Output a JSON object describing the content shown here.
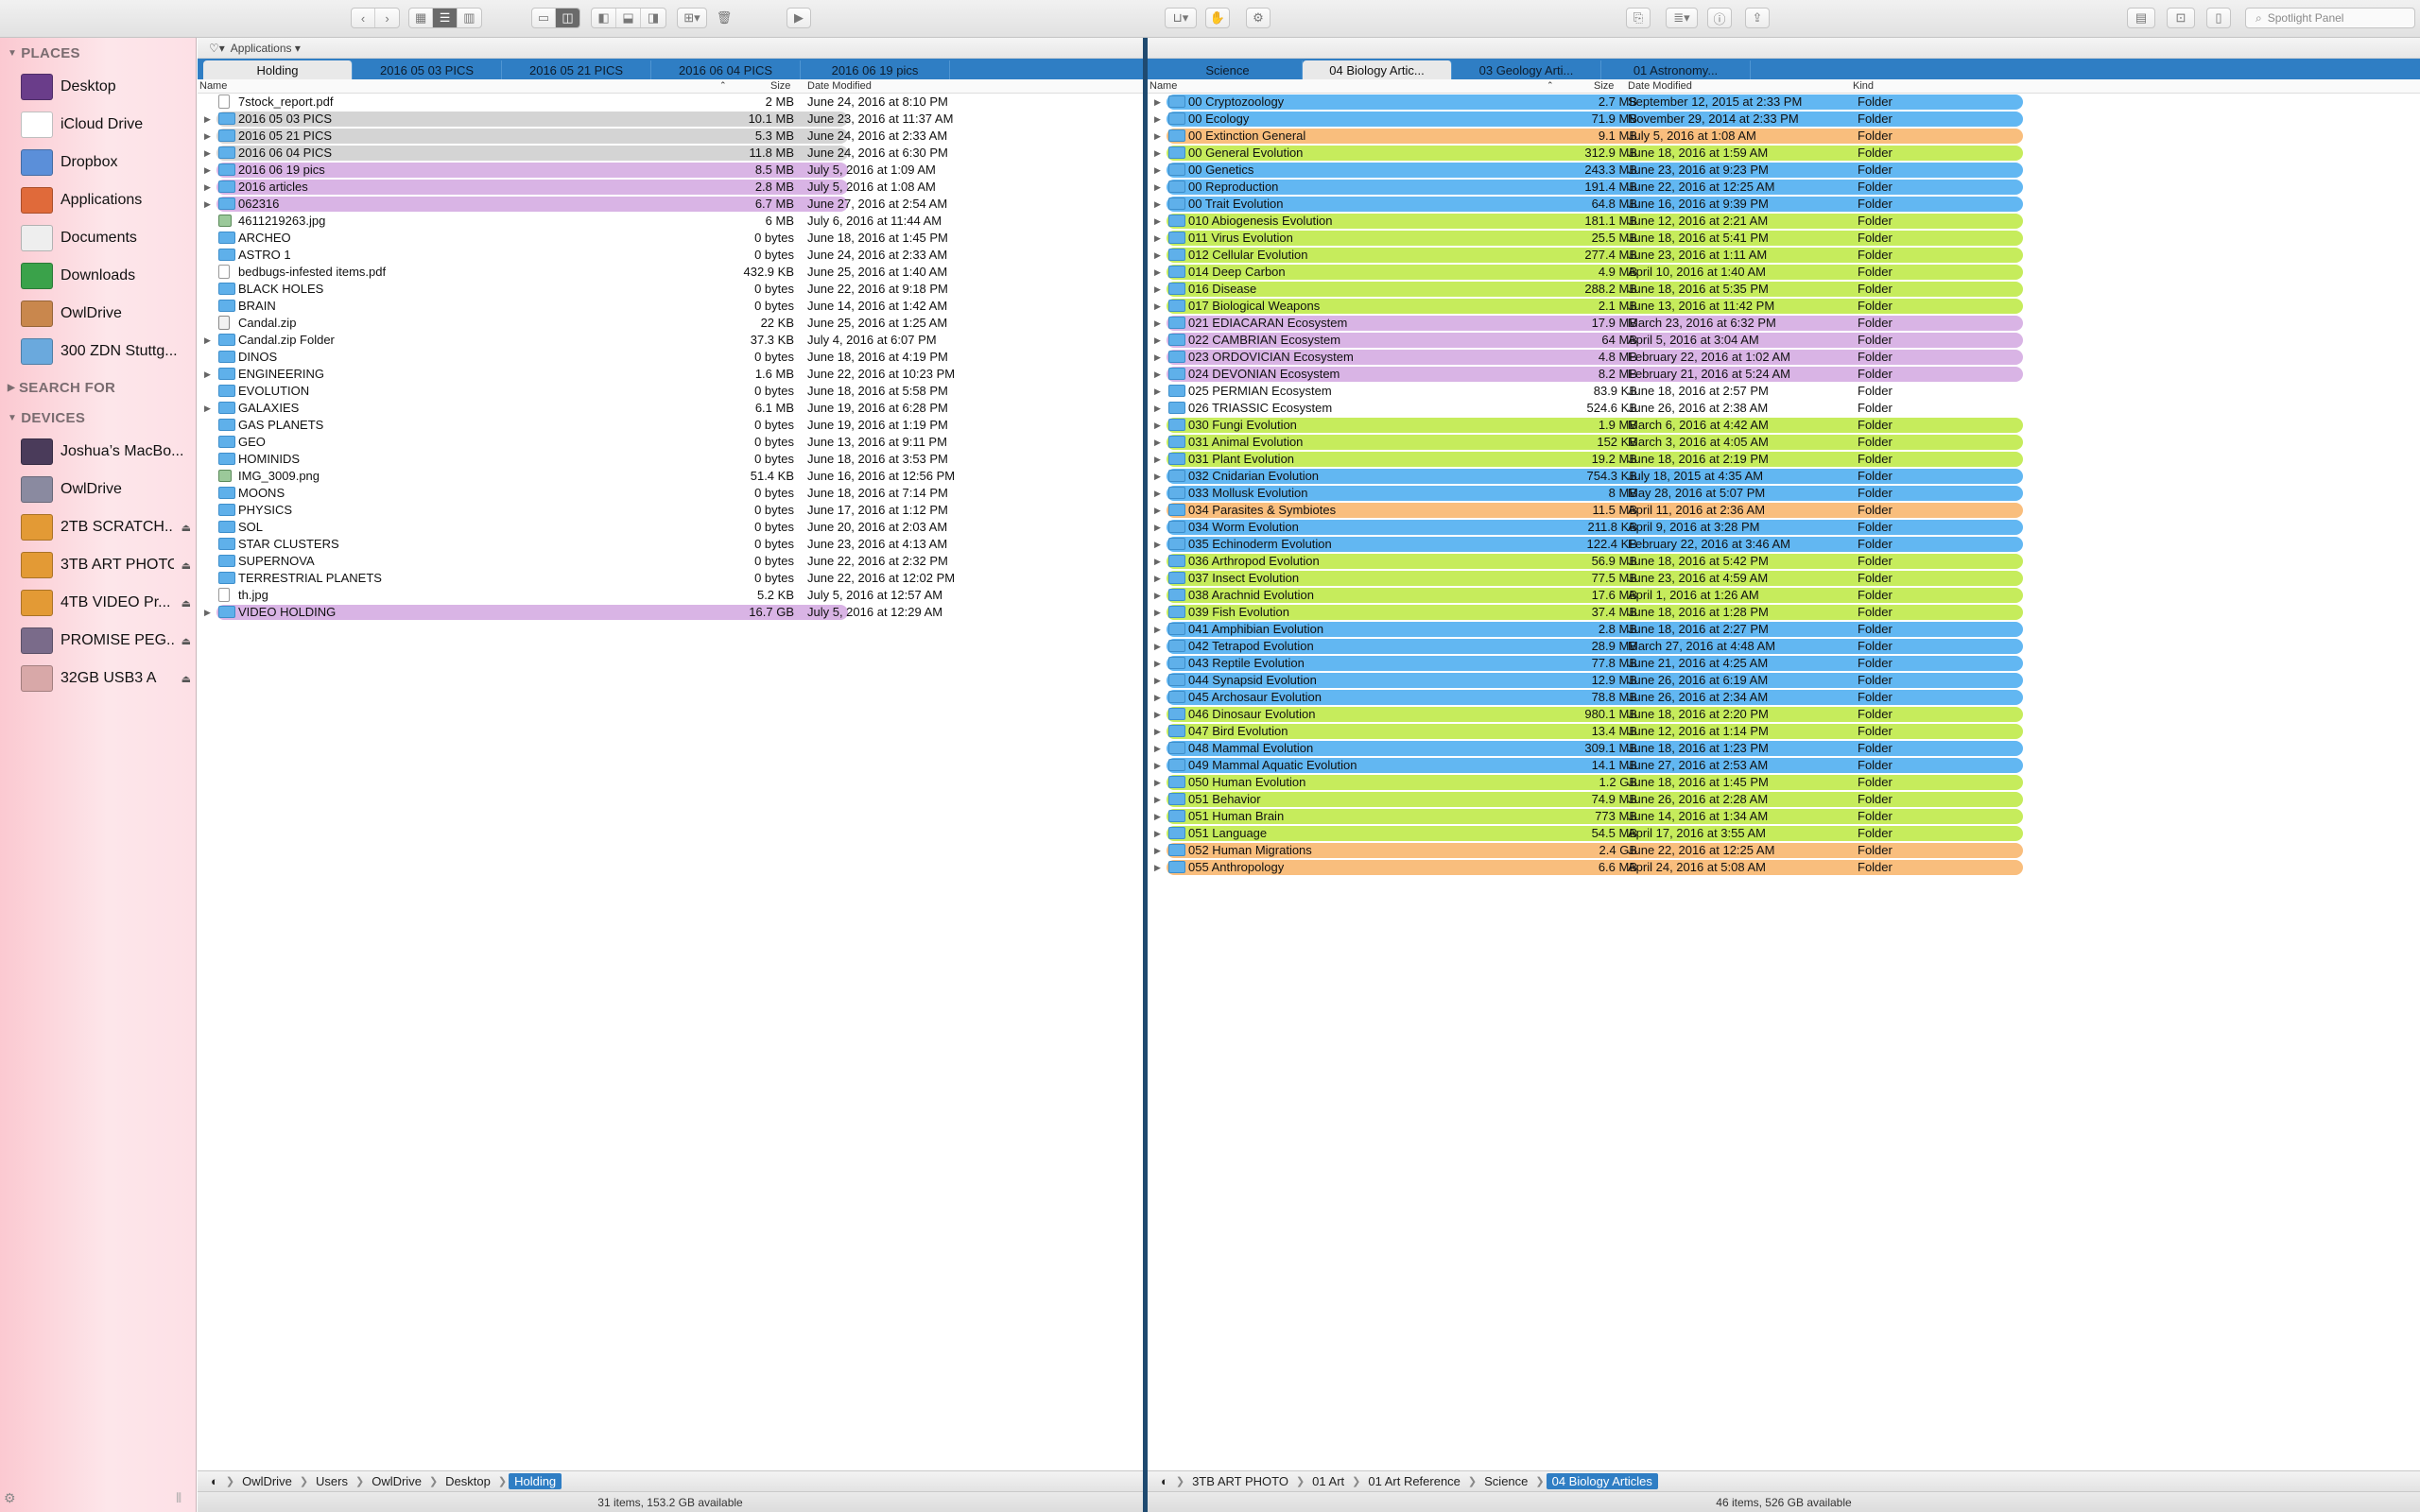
{
  "toolbar": {
    "back_icon": "chevron-left-icon",
    "forward_icon": "chevron-right-icon",
    "search_placeholder": "Spotlight Panel",
    "colors": {
      "accent": "#2f7ec4"
    }
  },
  "sidebar": {
    "sections": {
      "places": "PLACES",
      "search_for": "SEARCH FOR",
      "devices": "DEVICES"
    },
    "places": [
      {
        "label": "Desktop",
        "icon": "desktop-icon"
      },
      {
        "label": "iCloud Drive",
        "icon": "cloud-icon"
      },
      {
        "label": "Dropbox",
        "icon": "dropbox-icon"
      },
      {
        "label": "Applications",
        "icon": "applications-icon"
      },
      {
        "label": "Documents",
        "icon": "documents-icon"
      },
      {
        "label": "Downloads",
        "icon": "downloads-icon"
      },
      {
        "label": "OwlDrive",
        "icon": "home-icon"
      },
      {
        "label": "300 ZDN Stuttg...",
        "icon": "folder-icon"
      }
    ],
    "devices": [
      {
        "label": "Joshua’s MacBo...",
        "icon": "laptop-icon",
        "eject": ""
      },
      {
        "label": "OwlDrive",
        "icon": "disk-icon",
        "eject": ""
      },
      {
        "label": "2TB SCRATCH...",
        "icon": "external-disk-icon",
        "eject": "⏏"
      },
      {
        "label": "3TB ART PHOTO",
        "icon": "external-disk-icon",
        "eject": "⏏"
      },
      {
        "label": "4TB VIDEO Pr...",
        "icon": "external-disk-icon",
        "eject": "⏏"
      },
      {
        "label": "PROMISE PEG...",
        "icon": "raid-disk-icon",
        "eject": "⏏"
      },
      {
        "label": "32GB USB3 A",
        "icon": "usb-disk-icon",
        "eject": "⏏"
      }
    ]
  },
  "left": {
    "bookmark": "Applications ▾",
    "tabs": [
      "Holding",
      "2016 05 03 PICS",
      "2016 05 21 PICS",
      "2016 06 04 PICS",
      "2016 06 19 pics"
    ],
    "columns": {
      "name": "Name",
      "size": "Size",
      "date": "Date Modified"
    },
    "rows": [
      {
        "name": "7stock_report.pdf",
        "size": "2 MB",
        "date": "June 24, 2016 at 8:10 PM",
        "type": "doc",
        "dis": false,
        "color": ""
      },
      {
        "name": "2016 05 03 PICS",
        "size": "10.1 MB",
        "date": "June 23, 2016 at 11:37 AM",
        "type": "folder",
        "dis": true,
        "color": "#d4d4d4"
      },
      {
        "name": "2016 05 21 PICS",
        "size": "5.3 MB",
        "date": "June 24, 2016 at 2:33 AM",
        "type": "folder",
        "dis": true,
        "color": "#d4d4d4"
      },
      {
        "name": "2016 06 04 PICS",
        "size": "11.8 MB",
        "date": "June 24, 2016 at 6:30 PM",
        "type": "folder",
        "dis": true,
        "color": "#d4d4d4"
      },
      {
        "name": "2016 06 19 pics",
        "size": "8.5 MB",
        "date": "July 5, 2016 at 1:09 AM",
        "type": "folder",
        "dis": true,
        "color": "#d9b4e5"
      },
      {
        "name": "2016 articles",
        "size": "2.8 MB",
        "date": "July 5, 2016 at 1:08 AM",
        "type": "folder",
        "dis": true,
        "color": "#d9b4e5"
      },
      {
        "name": "062316",
        "size": "6.7 MB",
        "date": "June 27, 2016 at 2:54 AM",
        "type": "folder",
        "dis": true,
        "color": "#d9b4e5"
      },
      {
        "name": "4611219263.jpg",
        "size": "6 MB",
        "date": "July 6, 2016 at 11:44 AM",
        "type": "img",
        "dis": false,
        "color": ""
      },
      {
        "name": "ARCHEO",
        "size": "0 bytes",
        "date": "June 18, 2016 at 1:45 PM",
        "type": "folder",
        "dis": false,
        "color": ""
      },
      {
        "name": "ASTRO 1",
        "size": "0 bytes",
        "date": "June 24, 2016 at 2:33 AM",
        "type": "folder",
        "dis": false,
        "color": ""
      },
      {
        "name": "bedbugs-infested items.pdf",
        "size": "432.9 KB",
        "date": "June 25, 2016 at 1:40 AM",
        "type": "doc",
        "dis": false,
        "color": ""
      },
      {
        "name": "BLACK HOLES",
        "size": "0 bytes",
        "date": "June 22, 2016 at 9:18 PM",
        "type": "folder",
        "dis": false,
        "color": ""
      },
      {
        "name": "BRAIN",
        "size": "0 bytes",
        "date": "June 14, 2016 at 1:42 AM",
        "type": "folder",
        "dis": false,
        "color": ""
      },
      {
        "name": "Candal.zip",
        "size": "22 KB",
        "date": "June 25, 2016 at 1:25 AM",
        "type": "zip",
        "dis": false,
        "color": ""
      },
      {
        "name": "Candal.zip Folder",
        "size": "37.3 KB",
        "date": "July 4, 2016 at 6:07 PM",
        "type": "folder",
        "dis": true,
        "color": ""
      },
      {
        "name": "DINOS",
        "size": "0 bytes",
        "date": "June 18, 2016 at 4:19 PM",
        "type": "folder",
        "dis": false,
        "color": ""
      },
      {
        "name": "ENGINEERING",
        "size": "1.6 MB",
        "date": "June 22, 2016 at 10:23 PM",
        "type": "folder",
        "dis": true,
        "color": ""
      },
      {
        "name": "EVOLUTION",
        "size": "0 bytes",
        "date": "June 18, 2016 at 5:58 PM",
        "type": "folder",
        "dis": false,
        "color": ""
      },
      {
        "name": "GALAXIES",
        "size": "6.1 MB",
        "date": "June 19, 2016 at 6:28 PM",
        "type": "folder",
        "dis": true,
        "color": ""
      },
      {
        "name": "GAS PLANETS",
        "size": "0 bytes",
        "date": "June 19, 2016 at 1:19 PM",
        "type": "folder",
        "dis": false,
        "color": ""
      },
      {
        "name": "GEO",
        "size": "0 bytes",
        "date": "June 13, 2016 at 9:11 PM",
        "type": "folder",
        "dis": false,
        "color": ""
      },
      {
        "name": "HOMINIDS",
        "size": "0 bytes",
        "date": "June 18, 2016 at 3:53 PM",
        "type": "folder",
        "dis": false,
        "color": ""
      },
      {
        "name": "IMG_3009.png",
        "size": "51.4 KB",
        "date": "June 16, 2016 at 12:56 PM",
        "type": "img",
        "dis": false,
        "color": ""
      },
      {
        "name": "MOONS",
        "size": "0 bytes",
        "date": "June 18, 2016 at 7:14 PM",
        "type": "folder",
        "dis": false,
        "color": ""
      },
      {
        "name": "PHYSICS",
        "size": "0 bytes",
        "date": "June 17, 2016 at 1:12 PM",
        "type": "folder",
        "dis": false,
        "color": ""
      },
      {
        "name": "SOL",
        "size": "0 bytes",
        "date": "June 20, 2016 at 2:03 AM",
        "type": "folder",
        "dis": false,
        "color": ""
      },
      {
        "name": "STAR CLUSTERS",
        "size": "0 bytes",
        "date": "June 23, 2016 at 4:13 AM",
        "type": "folder",
        "dis": false,
        "color": ""
      },
      {
        "name": "SUPERNOVA",
        "size": "0 bytes",
        "date": "June 22, 2016 at 2:32 PM",
        "type": "folder",
        "dis": false,
        "color": ""
      },
      {
        "name": "TERRESTRIAL PLANETS",
        "size": "0 bytes",
        "date": "June 22, 2016 at 12:02 PM",
        "type": "folder",
        "dis": false,
        "color": ""
      },
      {
        "name": "th.jpg",
        "size": "5.2 KB",
        "date": "July 5, 2016 at 12:57 AM",
        "type": "doc",
        "dis": false,
        "color": ""
      },
      {
        "name": "VIDEO HOLDING",
        "size": "16.7 GB",
        "date": "July 5, 2016 at 12:29 AM",
        "type": "folder",
        "dis": true,
        "color": "#d9b4e5"
      }
    ],
    "path": [
      "OwlDrive",
      "Users",
      "OwlDrive",
      "Desktop",
      "Holding"
    ],
    "status": "31 items, 153.2 GB available"
  },
  "right": {
    "tabs": [
      "Science",
      "04 Biology Artic...",
      "03 Geology Arti...",
      "01 Astronomy..."
    ],
    "active_tab": 1,
    "columns": {
      "name": "Name",
      "size": "Size",
      "date": "Date Modified",
      "kind": "Kind"
    },
    "rows": [
      {
        "name": "00 Cryptozoology",
        "size": "2.7 MB",
        "date": "September 12, 2015 at 2:33 PM",
        "kind": "Folder",
        "color": "#62b7f2"
      },
      {
        "name": "00 Ecology",
        "size": "71.9 MB",
        "date": "November 29, 2014 at 2:33 PM",
        "kind": "Folder",
        "color": "#62b7f2"
      },
      {
        "name": "00 Extinction General",
        "size": "9.1 MB",
        "date": "July 5, 2016 at 1:08 AM",
        "kind": "Folder",
        "color": "#f9be7d"
      },
      {
        "name": "00 General Evolution",
        "size": "312.9 MB",
        "date": "June 18, 2016 at 1:59 AM",
        "kind": "Folder",
        "color": "#c6ec5c"
      },
      {
        "name": "00 Genetics",
        "size": "243.3 MB",
        "date": "June 23, 2016 at 9:23 PM",
        "kind": "Folder",
        "color": "#62b7f2"
      },
      {
        "name": "00 Reproduction",
        "size": "191.4 MB",
        "date": "June 22, 2016 at 12:25 AM",
        "kind": "Folder",
        "color": "#62b7f2"
      },
      {
        "name": "00 Trait Evolution",
        "size": "64.8 MB",
        "date": "June 16, 2016 at 9:39 PM",
        "kind": "Folder",
        "color": "#62b7f2"
      },
      {
        "name": "010 Abiogenesis Evolution",
        "size": "181.1 MB",
        "date": "June 12, 2016 at 2:21 AM",
        "kind": "Folder",
        "color": "#c6ec5c"
      },
      {
        "name": "011 Virus Evolution",
        "size": "25.5 MB",
        "date": "June 18, 2016 at 5:41 PM",
        "kind": "Folder",
        "color": "#c6ec5c"
      },
      {
        "name": "012 Cellular Evolution",
        "size": "277.4 MB",
        "date": "June 23, 2016 at 1:11 AM",
        "kind": "Folder",
        "color": "#c6ec5c"
      },
      {
        "name": "014 Deep Carbon",
        "size": "4.9 MB",
        "date": "April 10, 2016 at 1:40 AM",
        "kind": "Folder",
        "color": "#c6ec5c"
      },
      {
        "name": "016 Disease",
        "size": "288.2 MB",
        "date": "June 18, 2016 at 5:35 PM",
        "kind": "Folder",
        "color": "#c6ec5c"
      },
      {
        "name": "017 Biological Weapons",
        "size": "2.1 MB",
        "date": "June 13, 2016 at 11:42 PM",
        "kind": "Folder",
        "color": "#c6ec5c"
      },
      {
        "name": "021 EDIACARAN Ecosystem",
        "size": "17.9 MB",
        "date": "March 23, 2016 at 6:32 PM",
        "kind": "Folder",
        "color": "#d9b4e5"
      },
      {
        "name": "022 CAMBRIAN Ecosystem",
        "size": "64 MB",
        "date": "April 5, 2016 at 3:04 AM",
        "kind": "Folder",
        "color": "#d9b4e5"
      },
      {
        "name": "023 ORDOVICIAN Ecosystem",
        "size": "4.8 MB",
        "date": "February 22, 2016 at 1:02 AM",
        "kind": "Folder",
        "color": "#d9b4e5"
      },
      {
        "name": "024 DEVONIAN Ecosystem",
        "size": "8.2 MB",
        "date": "February 21, 2016 at 5:24 AM",
        "kind": "Folder",
        "color": "#d9b4e5"
      },
      {
        "name": "025 PERMIAN Ecosystem",
        "size": "83.9 KB",
        "date": "June 18, 2016 at 2:57 PM",
        "kind": "Folder",
        "color": ""
      },
      {
        "name": "026 TRIASSIC Ecosystem",
        "size": "524.6 KB",
        "date": "June 26, 2016 at 2:38 AM",
        "kind": "Folder",
        "color": ""
      },
      {
        "name": "030 Fungi Evolution",
        "size": "1.9 MB",
        "date": "March 6, 2016 at 4:42 AM",
        "kind": "Folder",
        "color": "#c6ec5c"
      },
      {
        "name": "031 Animal Evolution",
        "size": "152 KB",
        "date": "March 3, 2016 at 4:05 AM",
        "kind": "Folder",
        "color": "#c6ec5c"
      },
      {
        "name": "031 Plant Evolution",
        "size": "19.2 MB",
        "date": "June 18, 2016 at 2:19 PM",
        "kind": "Folder",
        "color": "#c6ec5c"
      },
      {
        "name": "032 Cnidarian Evolution",
        "size": "754.3 KB",
        "date": "July 18, 2015 at 4:35 AM",
        "kind": "Folder",
        "color": "#62b7f2"
      },
      {
        "name": "033 Mollusk Evolution",
        "size": "8 MB",
        "date": "May 28, 2016 at 5:07 PM",
        "kind": "Folder",
        "color": "#62b7f2"
      },
      {
        "name": "034 Parasites & Symbiotes",
        "size": "11.5 MB",
        "date": "April 11, 2016 at 2:36 AM",
        "kind": "Folder",
        "color": "#f9be7d"
      },
      {
        "name": "034 Worm Evolution",
        "size": "211.8 KB",
        "date": "April 9, 2016 at 3:28 PM",
        "kind": "Folder",
        "color": "#62b7f2"
      },
      {
        "name": "035 Echinoderm Evolution",
        "size": "122.4 KB",
        "date": "February 22, 2016 at 3:46 AM",
        "kind": "Folder",
        "color": "#62b7f2"
      },
      {
        "name": "036 Arthropod Evolution",
        "size": "56.9 MB",
        "date": "June 18, 2016 at 5:42 PM",
        "kind": "Folder",
        "color": "#c6ec5c"
      },
      {
        "name": "037 Insect Evolution",
        "size": "77.5 MB",
        "date": "June 23, 2016 at 4:59 AM",
        "kind": "Folder",
        "color": "#c6ec5c"
      },
      {
        "name": "038 Arachnid Evolution",
        "size": "17.6 MB",
        "date": "April 1, 2016 at 1:26 AM",
        "kind": "Folder",
        "color": "#c6ec5c"
      },
      {
        "name": "039 Fish Evolution",
        "size": "37.4 MB",
        "date": "June 18, 2016 at 1:28 PM",
        "kind": "Folder",
        "color": "#c6ec5c"
      },
      {
        "name": "041 Amphibian Evolution",
        "size": "2.8 MB",
        "date": "June 18, 2016 at 2:27 PM",
        "kind": "Folder",
        "color": "#62b7f2"
      },
      {
        "name": "042 Tetrapod Evolution",
        "size": "28.9 MB",
        "date": "March 27, 2016 at 4:48 AM",
        "kind": "Folder",
        "color": "#62b7f2"
      },
      {
        "name": "043 Reptile Evolution",
        "size": "77.8 MB",
        "date": "June 21, 2016 at 4:25 AM",
        "kind": "Folder",
        "color": "#62b7f2"
      },
      {
        "name": "044 Synapsid Evolution",
        "size": "12.9 MB",
        "date": "June 26, 2016 at 6:19 AM",
        "kind": "Folder",
        "color": "#62b7f2"
      },
      {
        "name": "045 Archosaur Evolution",
        "size": "78.8 MB",
        "date": "June 26, 2016 at 2:34 AM",
        "kind": "Folder",
        "color": "#62b7f2"
      },
      {
        "name": "046 Dinosaur Evolution",
        "size": "980.1 MB",
        "date": "June 18, 2016 at 2:20 PM",
        "kind": "Folder",
        "color": "#c6ec5c"
      },
      {
        "name": "047 Bird Evolution",
        "size": "13.4 MB",
        "date": "June 12, 2016 at 1:14 PM",
        "kind": "Folder",
        "color": "#c6ec5c"
      },
      {
        "name": "048 Mammal Evolution",
        "size": "309.1 MB",
        "date": "June 18, 2016 at 1:23 PM",
        "kind": "Folder",
        "color": "#62b7f2"
      },
      {
        "name": "049 Mammal Aquatic Evolution",
        "size": "14.1 MB",
        "date": "June 27, 2016 at 2:53 AM",
        "kind": "Folder",
        "color": "#62b7f2"
      },
      {
        "name": "050 Human Evolution",
        "size": "1.2 GB",
        "date": "June 18, 2016 at 1:45 PM",
        "kind": "Folder",
        "color": "#c6ec5c"
      },
      {
        "name": "051 Behavior",
        "size": "74.9 MB",
        "date": "June 26, 2016 at 2:28 AM",
        "kind": "Folder",
        "color": "#c6ec5c"
      },
      {
        "name": "051 Human Brain",
        "size": "773 MB",
        "date": "June 14, 2016 at 1:34 AM",
        "kind": "Folder",
        "color": "#c6ec5c"
      },
      {
        "name": "051 Language",
        "size": "54.5 MB",
        "date": "April 17, 2016 at 3:55 AM",
        "kind": "Folder",
        "color": "#c6ec5c"
      },
      {
        "name": "052 Human Migrations",
        "size": "2.4 GB",
        "date": "June 22, 2016 at 12:25 AM",
        "kind": "Folder",
        "color": "#f9be7d"
      },
      {
        "name": "055 Anthropology",
        "size": "6.6 MB",
        "date": "April 24, 2016 at 5:08 AM",
        "kind": "Folder",
        "color": "#f9be7d"
      }
    ],
    "path": [
      "3TB ART PHOTO",
      "01 Art",
      "01 Art Reference",
      "Science",
      "04 Biology Articles"
    ],
    "status": "46 items, 526 GB available"
  }
}
